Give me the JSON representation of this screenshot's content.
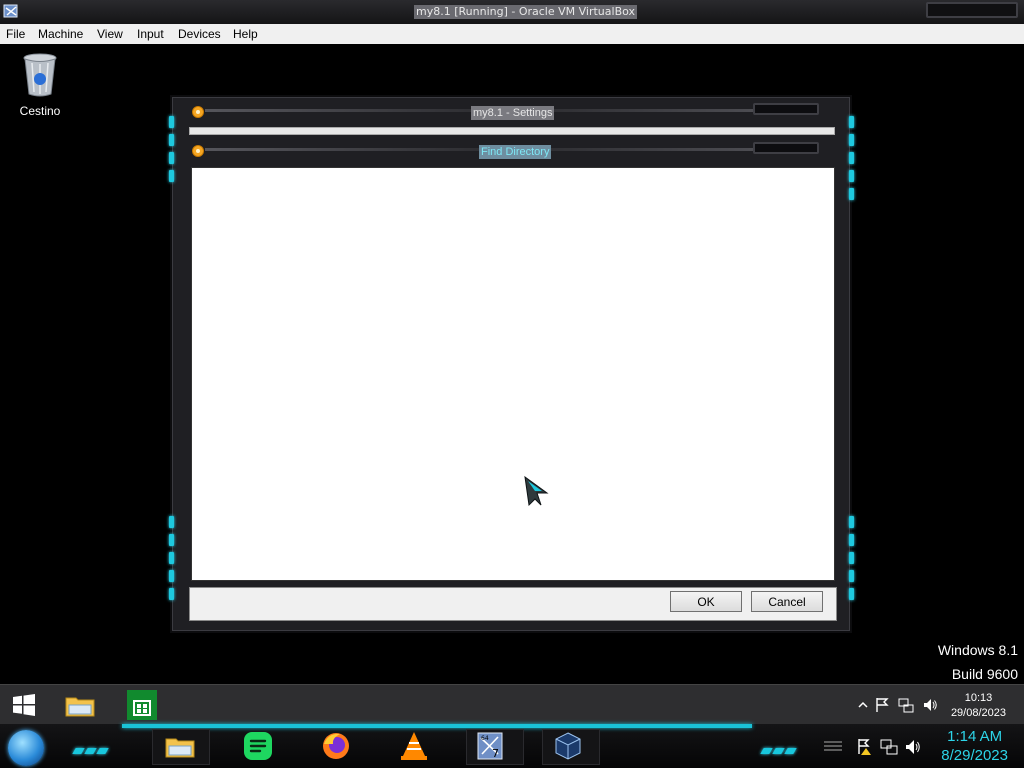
{
  "host_window": {
    "title": "my8.1 [Running] - Oracle VM VirtualBox",
    "menu": [
      "File",
      "Machine",
      "View",
      "Input",
      "Devices",
      "Help"
    ]
  },
  "desktop": {
    "recycle_bin_label": "Cestino",
    "watermark_line1": "Windows 8.1",
    "watermark_line2": "Build 9600"
  },
  "settings_window": {
    "title": "my8.1 - Settings"
  },
  "find_directory_dialog": {
    "title": "Find Directory",
    "ok_label": "OK",
    "cancel_label": "Cancel"
  },
  "guest_taskbar": {
    "icons": [
      "start-icon",
      "file-explorer-icon",
      "store-icon"
    ],
    "tray_icons": [
      "show-hidden-icons-icon",
      "action-center-flag-icon",
      "network-icon",
      "volume-icon"
    ],
    "time": "10:13",
    "date": "29/08/2023"
  },
  "host_taskbar": {
    "icons": [
      "start-orb-icon",
      "file-explorer-icon",
      "spotify-icon",
      "firefox-icon",
      "vlc-icon",
      "windows7-64-icon",
      "virtualbox-icon"
    ],
    "tray_icons": [
      "show-desktop-icon",
      "action-center-warning-flag-icon",
      "network-icon",
      "volume-icon"
    ],
    "time": "1:14 AM",
    "date": "8/29/2023"
  },
  "colors": {
    "accent_cyan": "#1ec9df",
    "title_highlight": "#7ee7f5",
    "host_clock": "#2dd4e8"
  }
}
